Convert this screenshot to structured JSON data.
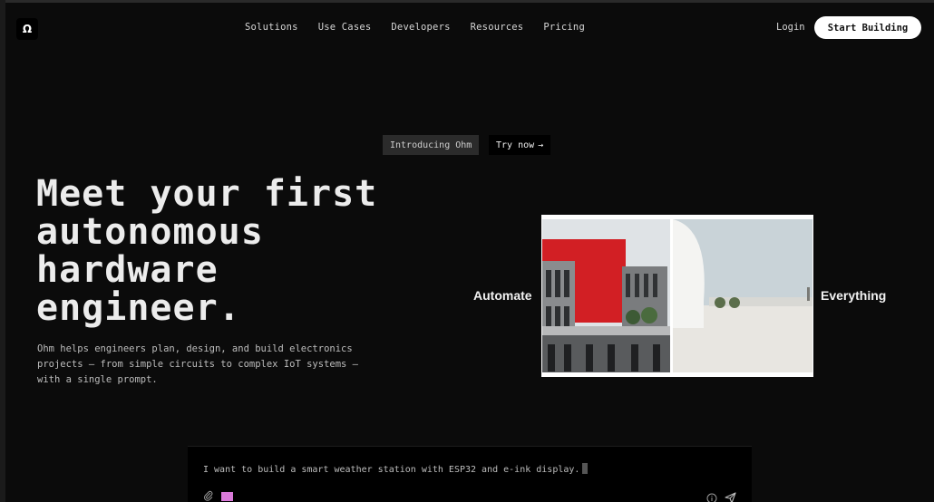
{
  "nav": {
    "logo": "Ω",
    "links": [
      "Solutions",
      "Use Cases",
      "Developers",
      "Resources",
      "Pricing"
    ],
    "login": "Login",
    "cta": "Start Building"
  },
  "intro": {
    "badge": "Introducing Ohm",
    "try_label": "Try now",
    "try_arrow": "→"
  },
  "hero": {
    "title": "Meet your first autonomous hardware engineer.",
    "description": "Ohm helps engineers plan, design, and build electronics projects — from simple circuits to complex IoT systems — with a single prompt."
  },
  "showcase": {
    "left_word": "Automate",
    "right_word": "Everything"
  },
  "prompt": {
    "text": "I want to build a smart weather station with ESP32 and e-ink display."
  },
  "colors": {
    "background": "#0b0b0b",
    "accent_pink": "#d97ad9",
    "building_red": "#d21f24"
  }
}
